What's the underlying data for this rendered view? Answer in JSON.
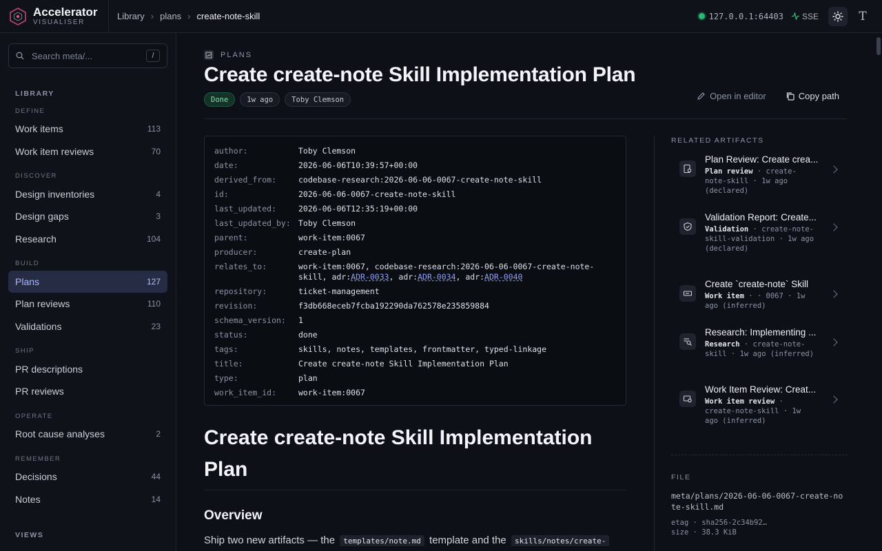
{
  "app": {
    "name": "Accelerator",
    "subtitle": "VISUALISER"
  },
  "breadcrumb": [
    "Library",
    "plans",
    "create-note-skill"
  ],
  "connection": {
    "address": "127.0.0.1:64403",
    "status_color": "#2bb673",
    "transport": "SSE"
  },
  "search": {
    "placeholder": "Search meta/...",
    "shortcut": "/"
  },
  "sidebar": {
    "library_title": "LIBRARY",
    "groups": [
      {
        "title": "DEFINE",
        "items": [
          {
            "label": "Work items",
            "count": "113"
          },
          {
            "label": "Work item reviews",
            "count": "70"
          }
        ]
      },
      {
        "title": "DISCOVER",
        "items": [
          {
            "label": "Design inventories",
            "count": "4"
          },
          {
            "label": "Design gaps",
            "count": "3"
          },
          {
            "label": "Research",
            "count": "104"
          }
        ]
      },
      {
        "title": "BUILD",
        "items": [
          {
            "label": "Plans",
            "count": "127",
            "active": true
          },
          {
            "label": "Plan reviews",
            "count": "110"
          },
          {
            "label": "Validations",
            "count": "23"
          }
        ]
      },
      {
        "title": "SHIP",
        "items": [
          {
            "label": "PR descriptions",
            "count": ""
          },
          {
            "label": "PR reviews",
            "count": ""
          }
        ]
      },
      {
        "title": "OPERATE",
        "items": [
          {
            "label": "Root cause analyses",
            "count": "2"
          }
        ]
      },
      {
        "title": "REMEMBER",
        "items": [
          {
            "label": "Decisions",
            "count": "44"
          },
          {
            "label": "Notes",
            "count": "14"
          }
        ]
      }
    ],
    "views_title": "VIEWS"
  },
  "doc": {
    "kind": "PLANS",
    "title": "Create create-note Skill Implementation Plan",
    "badges": {
      "status": "Done",
      "age": "1w ago",
      "author": "Toby Clemson"
    },
    "actions": {
      "open_editor": "Open in editor",
      "copy_path": "Copy path"
    },
    "frontmatter": [
      {
        "key": "author:",
        "value": "Toby Clemson"
      },
      {
        "key": "date:",
        "value": "2026-06-06T10:39:57+00:00"
      },
      {
        "key": "derived_from:",
        "value": "codebase-research:2026-06-06-0067-create-note-skill"
      },
      {
        "key": "id:",
        "value": "2026-06-06-0067-create-note-skill"
      },
      {
        "key": "last_updated:",
        "value": "2026-06-06T12:35:19+00:00"
      },
      {
        "key": "last_updated_by:",
        "value": "Toby Clemson"
      },
      {
        "key": "parent:",
        "value": "work-item:0067"
      },
      {
        "key": "producer:",
        "value": "create-plan"
      },
      {
        "key": "relates_to:",
        "value": "work-item:0067, codebase-research:2026-06-06-0067-create-note-skill, adr:",
        "links": [
          "ADR-0033",
          "ADR-0034",
          "ADR-0040"
        ]
      },
      {
        "key": "repository:",
        "value": "ticket-management"
      },
      {
        "key": "revision:",
        "value": "f3db668eceb7fcba192290da762578e235859884"
      },
      {
        "key": "schema_version:",
        "value": "1"
      },
      {
        "key": "status:",
        "value": "done"
      },
      {
        "key": "tags:",
        "value": "skills, notes, templates, frontmatter, typed-linkage"
      },
      {
        "key": "title:",
        "value": "Create create-note Skill Implementation Plan"
      },
      {
        "key": "type:",
        "value": "plan"
      },
      {
        "key": "work_item_id:",
        "value": "work-item:0067"
      }
    ],
    "body_heading": "Create create-note Skill Implementation Plan",
    "overview_heading": "Overview",
    "overview_text_1": "Ship two new artifacts — the",
    "overview_code_1": "templates/note.md",
    "overview_text_2": "template and the",
    "overview_code_2": "skills/notes/create-"
  },
  "related": {
    "title": "RELATED ARTIFACTS",
    "items": [
      {
        "title": "Plan Review: Create crea...",
        "type": "Plan review",
        "meta": "create-note-skill ·",
        "when": "1w ago",
        "how": "(declared)",
        "icon": "plan-review-icon"
      },
      {
        "title": "Validation Report: Create...",
        "type": "Validation",
        "meta": "create-note-skill-validation",
        "when": "· 1w ago",
        "how": "(declared)",
        "icon": "shield-check-icon"
      },
      {
        "title": "Create `create-note` Skill",
        "type": "Work item",
        "meta": "· 0067 ·",
        "when": "1w ago",
        "how": "(inferred)",
        "icon": "ticket-icon"
      },
      {
        "title": "Research: Implementing ...",
        "type": "Research",
        "meta": "create-note-skill ·",
        "when": "1w ago",
        "how": "(inferred)",
        "icon": "research-icon"
      },
      {
        "title": "Work Item Review: Creat...",
        "type": "Work item review",
        "meta": "create-note-skill ·",
        "when": "1w ago",
        "how": "(inferred)",
        "icon": "work-item-review-icon"
      }
    ]
  },
  "file": {
    "title": "FILE",
    "path": "meta/plans/2026-06-06-0067-create-note-skill.md",
    "etag": "etag · sha256-2c34b92…",
    "size": "size · 38.3 KiB"
  }
}
